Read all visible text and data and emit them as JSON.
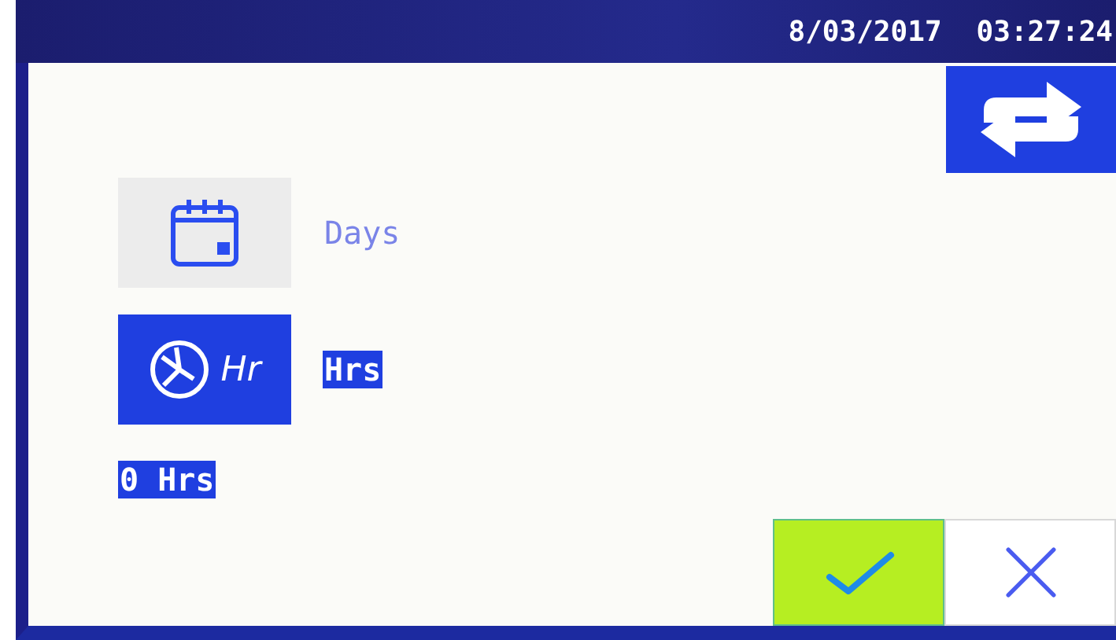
{
  "status_bar": {
    "date": "8/03/2017",
    "time": "03:27:24"
  },
  "unit_options": [
    {
      "kind": "calendar",
      "selected": false,
      "label": "Days"
    },
    {
      "kind": "clock",
      "selected": true,
      "icon_text": "Hr",
      "label": "Hrs"
    }
  ],
  "value": "0 Hrs",
  "actions": [
    {
      "kind": "confirm"
    },
    {
      "kind": "cancel"
    }
  ]
}
